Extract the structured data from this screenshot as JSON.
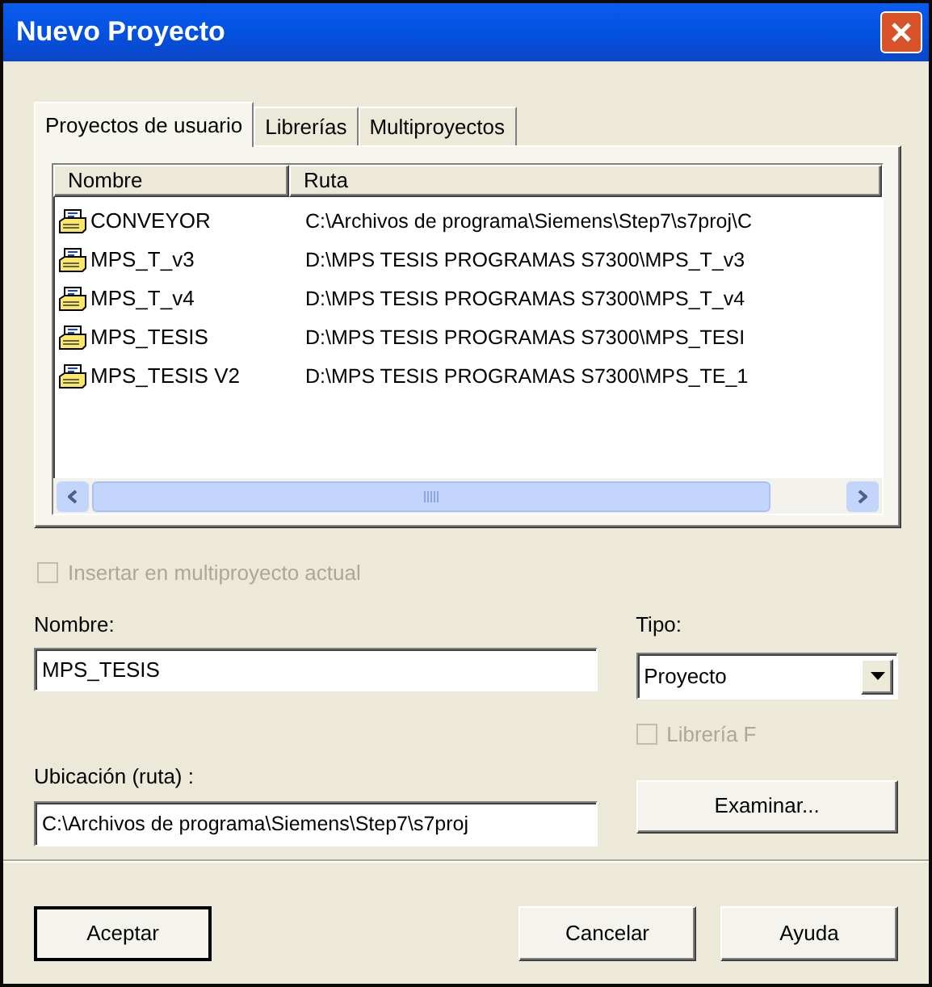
{
  "window": {
    "title": "Nuevo Proyecto"
  },
  "tabs": [
    {
      "label": "Proyectos de usuario",
      "selected": true
    },
    {
      "label": "Librerías",
      "selected": false
    },
    {
      "label": "Multiproyectos",
      "selected": false
    }
  ],
  "list": {
    "columns": [
      "Nombre",
      "Ruta"
    ],
    "rows": [
      {
        "name": "CONVEYOR",
        "path": "C:\\Archivos de programa\\Siemens\\Step7\\s7proj\\C"
      },
      {
        "name": "MPS_T_v3",
        "path": "D:\\MPS TESIS PROGRAMAS S7300\\MPS_T_v3"
      },
      {
        "name": "MPS_T_v4",
        "path": "D:\\MPS TESIS PROGRAMAS S7300\\MPS_T_v4"
      },
      {
        "name": "MPS_TESIS",
        "path": "D:\\MPS TESIS PROGRAMAS S7300\\MPS_TESI"
      },
      {
        "name": "MPS_TESIS V2",
        "path": "D:\\MPS TESIS PROGRAMAS S7300\\MPS_TE_1"
      }
    ]
  },
  "insert_checkbox": {
    "label": "Insertar en multiproyecto actual",
    "checked": false,
    "disabled": true
  },
  "name_field": {
    "label": "Nombre:",
    "value": "MPS_TESIS"
  },
  "type_select": {
    "label": "Tipo:",
    "value": "Proyecto"
  },
  "flibrary_checkbox": {
    "label": "Librería F",
    "checked": false,
    "disabled": true
  },
  "location_field": {
    "label": "Ubicación (ruta) :",
    "value": "C:\\Archivos de programa\\Siemens\\Step7\\s7proj"
  },
  "browse_button": "Examinar...",
  "buttons": [
    "Aceptar",
    "Cancelar",
    "Ayuda"
  ]
}
